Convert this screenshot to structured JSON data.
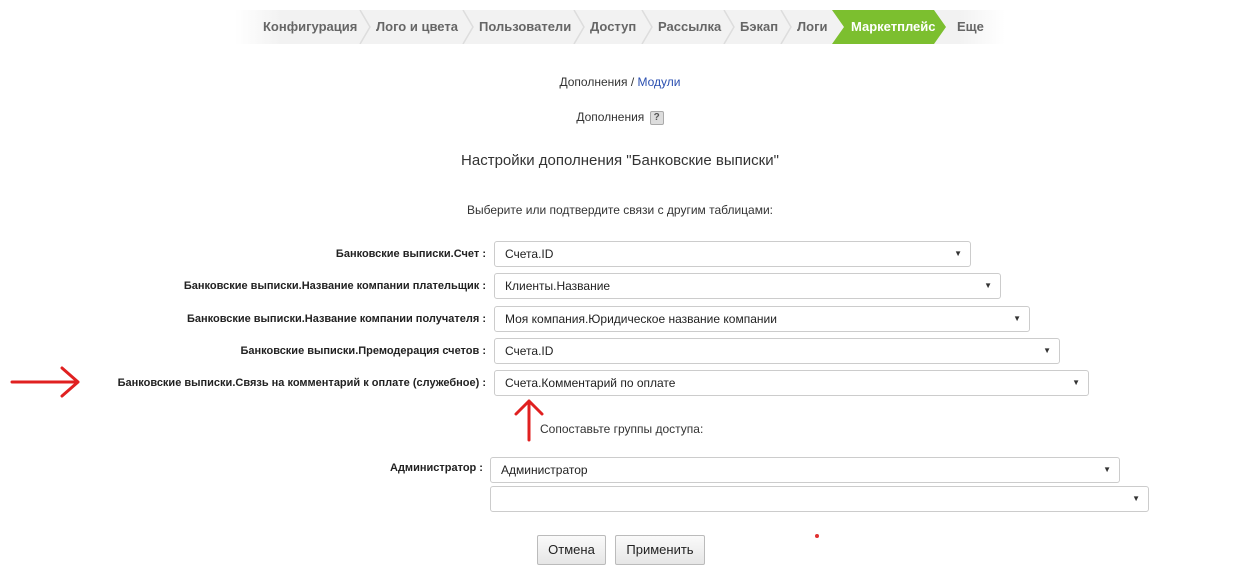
{
  "nav": {
    "items": [
      "Конфигурация",
      "Лого и цвета",
      "Пользователи",
      "Доступ",
      "Рассылка",
      "Бэкап",
      "Логи",
      "Маркетплейс",
      "Еще"
    ],
    "active": "Маркетплейс",
    "active_color": "#7cbf2f"
  },
  "breadcrumb": {
    "parent": "Дополнения",
    "separator": " / ",
    "current": "Модули"
  },
  "section": {
    "label": "Дополнения",
    "help_icon": "?"
  },
  "title": "Настройки дополнения \"Банковские выписки\"",
  "instruction": "Выберите или подтвердите связи с другим таблицами:",
  "mappings": [
    {
      "label": "Банковские выписки.Счет :",
      "value": "Счета.ID"
    },
    {
      "label": "Банковские выписки.Название компании плательщик :",
      "value": "Клиенты.Название"
    },
    {
      "label": "Банковские выписки.Название компании получателя :",
      "value": "Моя компания.Юридическое название компании"
    },
    {
      "label": "Банковские выписки.Премодерация счетов :",
      "value": "Счета.ID"
    },
    {
      "label": "Банковские выписки.Связь на комментарий к оплате (служебное) :",
      "value": "Счета.Комментарий по оплате"
    }
  ],
  "groups": {
    "label": "Сопоставьте группы доступа:",
    "admin_label": "Администратор :",
    "admin_value": "Администратор",
    "second_value": ""
  },
  "buttons": {
    "cancel": "Отмена",
    "apply": "Применить"
  },
  "annotation_color": "#e02020"
}
